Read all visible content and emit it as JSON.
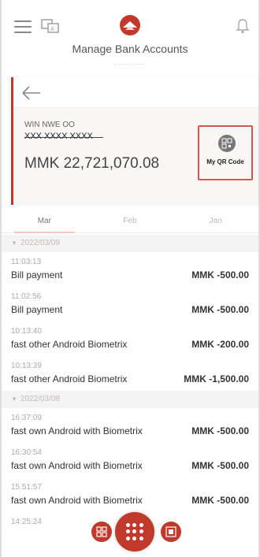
{
  "header": {
    "title": "Manage Bank Accounts",
    "subtitle": "··········"
  },
  "account": {
    "name": "WIN NWE OO",
    "number": "XXX XXXX XXXX",
    "balance": "MMK  22,721,070.08",
    "qr_label": "My QR Code"
  },
  "tabs": [
    {
      "label": "Mar",
      "active": true
    },
    {
      "label": "Feb",
      "active": false
    },
    {
      "label": "Jan",
      "active": false
    }
  ],
  "groups": [
    {
      "date": "2022/03/09",
      "items": [
        {
          "time": "11:03:13",
          "desc": "Bill payment",
          "amount": "MMK  -500.00"
        },
        {
          "time": "11:02:56",
          "desc": "Bill payment",
          "amount": "MMK  -500.00"
        },
        {
          "time": "10:13:40",
          "desc": "fast other Android Biometrix",
          "amount": "MMK  -200.00"
        },
        {
          "time": "10:13:39",
          "desc": "fast other Android Biometrix",
          "amount": "MMK  -1,500.00"
        }
      ]
    },
    {
      "date": "2022/03/08",
      "items": [
        {
          "time": "16:37:09",
          "desc": "fast own Android with Biometrix",
          "amount": "MMK  -500.00"
        },
        {
          "time": "16:30:54",
          "desc": "fast own Android with Biometrix",
          "amount": "MMK  -500.00"
        },
        {
          "time": "15:51:57",
          "desc": "fast own Android with Biometrix",
          "amount": "MMK  -500.00"
        },
        {
          "time": "14:25:24",
          "desc": "",
          "amount": ""
        }
      ]
    }
  ],
  "colors": {
    "accent": "#c0392b",
    "highlight_border": "#d9534f"
  },
  "icons": {
    "menu": "menu-icon",
    "language": "language-icon",
    "logo": "bank-logo-icon",
    "notification": "bell-icon",
    "back": "back-arrow-icon",
    "qr": "qr-code-icon",
    "nav_left": "qr-scan-icon",
    "nav_center": "grid-menu-icon",
    "nav_right": "qr-code-icon"
  }
}
